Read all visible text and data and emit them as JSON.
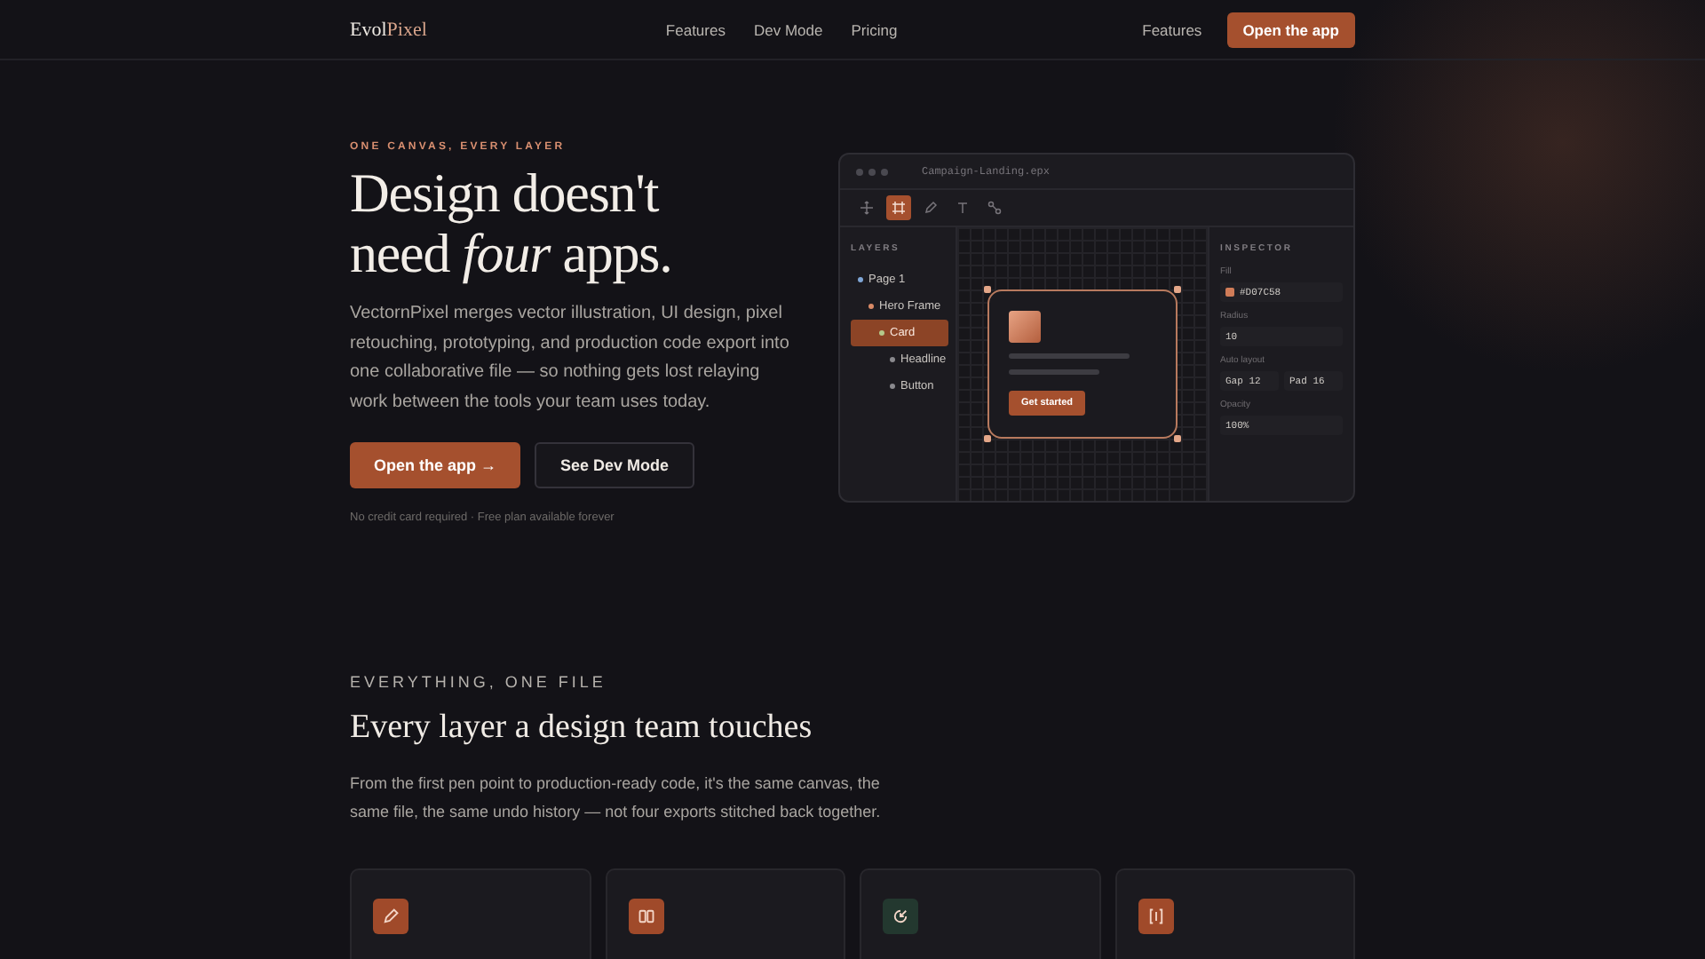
{
  "nav": {
    "logo": {
      "first": "Evol",
      "second": "Pixel"
    },
    "links": [
      "Features",
      "Dev Mode",
      "Pricing"
    ],
    "right_link": "Features",
    "cta": "Open the app"
  },
  "hero": {
    "eyebrow": "ONE CANVAS, EVERY LAYER",
    "title_lines": [
      "Design doesn't",
      "need *four* apps."
    ],
    "body": "VectornPixel merges vector illustration, UI design, pixel retouching, prototyping, and production code export into one collaborative file — so nothing gets lost relaying work between the tools your team uses today.",
    "primary_button": "Open the app →",
    "secondary_button": "See Dev Mode",
    "note": "No credit card required · Free plan available forever"
  },
  "mockup": {
    "file_name": "Campaign-Landing.epx",
    "tools": [
      {
        "kind": "move",
        "selected": false
      },
      {
        "kind": "frame",
        "selected": true
      },
      {
        "kind": "pen",
        "selected": false
      },
      {
        "kind": "text",
        "selected": false
      },
      {
        "kind": "nodes",
        "selected": false
      }
    ],
    "layers_title": "LAYERS",
    "layers": [
      {
        "name": "Page 1",
        "color": "#7fa6d6",
        "selected": false,
        "children": [
          {
            "name": "Hero Frame",
            "color": "#d98a66",
            "selected": false,
            "children": [
              {
                "name": "Card",
                "color": "#b5c98a",
                "selected": true,
                "children": [
                  {
                    "name": "Headline",
                    "color": "#8a8a8e",
                    "selected": false
                  },
                  {
                    "name": "Button",
                    "color": "#8a8a8e",
                    "selected": false
                  }
                ]
              }
            ]
          }
        ]
      }
    ],
    "canvas_button": "Get started",
    "inspector_title": "INSPECTOR",
    "inspector": [
      {
        "label": "Fill",
        "kind": "color",
        "values": [
          "#D07C58"
        ],
        "color": "#d07c58"
      },
      {
        "label": "Radius",
        "kind": "text",
        "values": [
          "10"
        ]
      },
      {
        "label": "Auto layout",
        "kind": "pair",
        "values": [
          "Gap 12",
          "Pad 16"
        ]
      },
      {
        "label": "Opacity",
        "kind": "text",
        "values": [
          "100%"
        ]
      }
    ]
  },
  "section": {
    "eyebrow": "EVERYTHING, ONE FILE",
    "heading": "Every layer a design team touches",
    "body": "From the first pen point to production-ready code, it's the same canvas, the same file, the same undo history — not four exports stitched back together.",
    "cards": [
      {
        "kind": "pen",
        "color": "#a04a2a"
      },
      {
        "kind": "columns",
        "color": "#a04a2a"
      },
      {
        "kind": "crop",
        "color": "#23382f"
      },
      {
        "kind": "code",
        "color": "#a04a2a"
      }
    ]
  }
}
